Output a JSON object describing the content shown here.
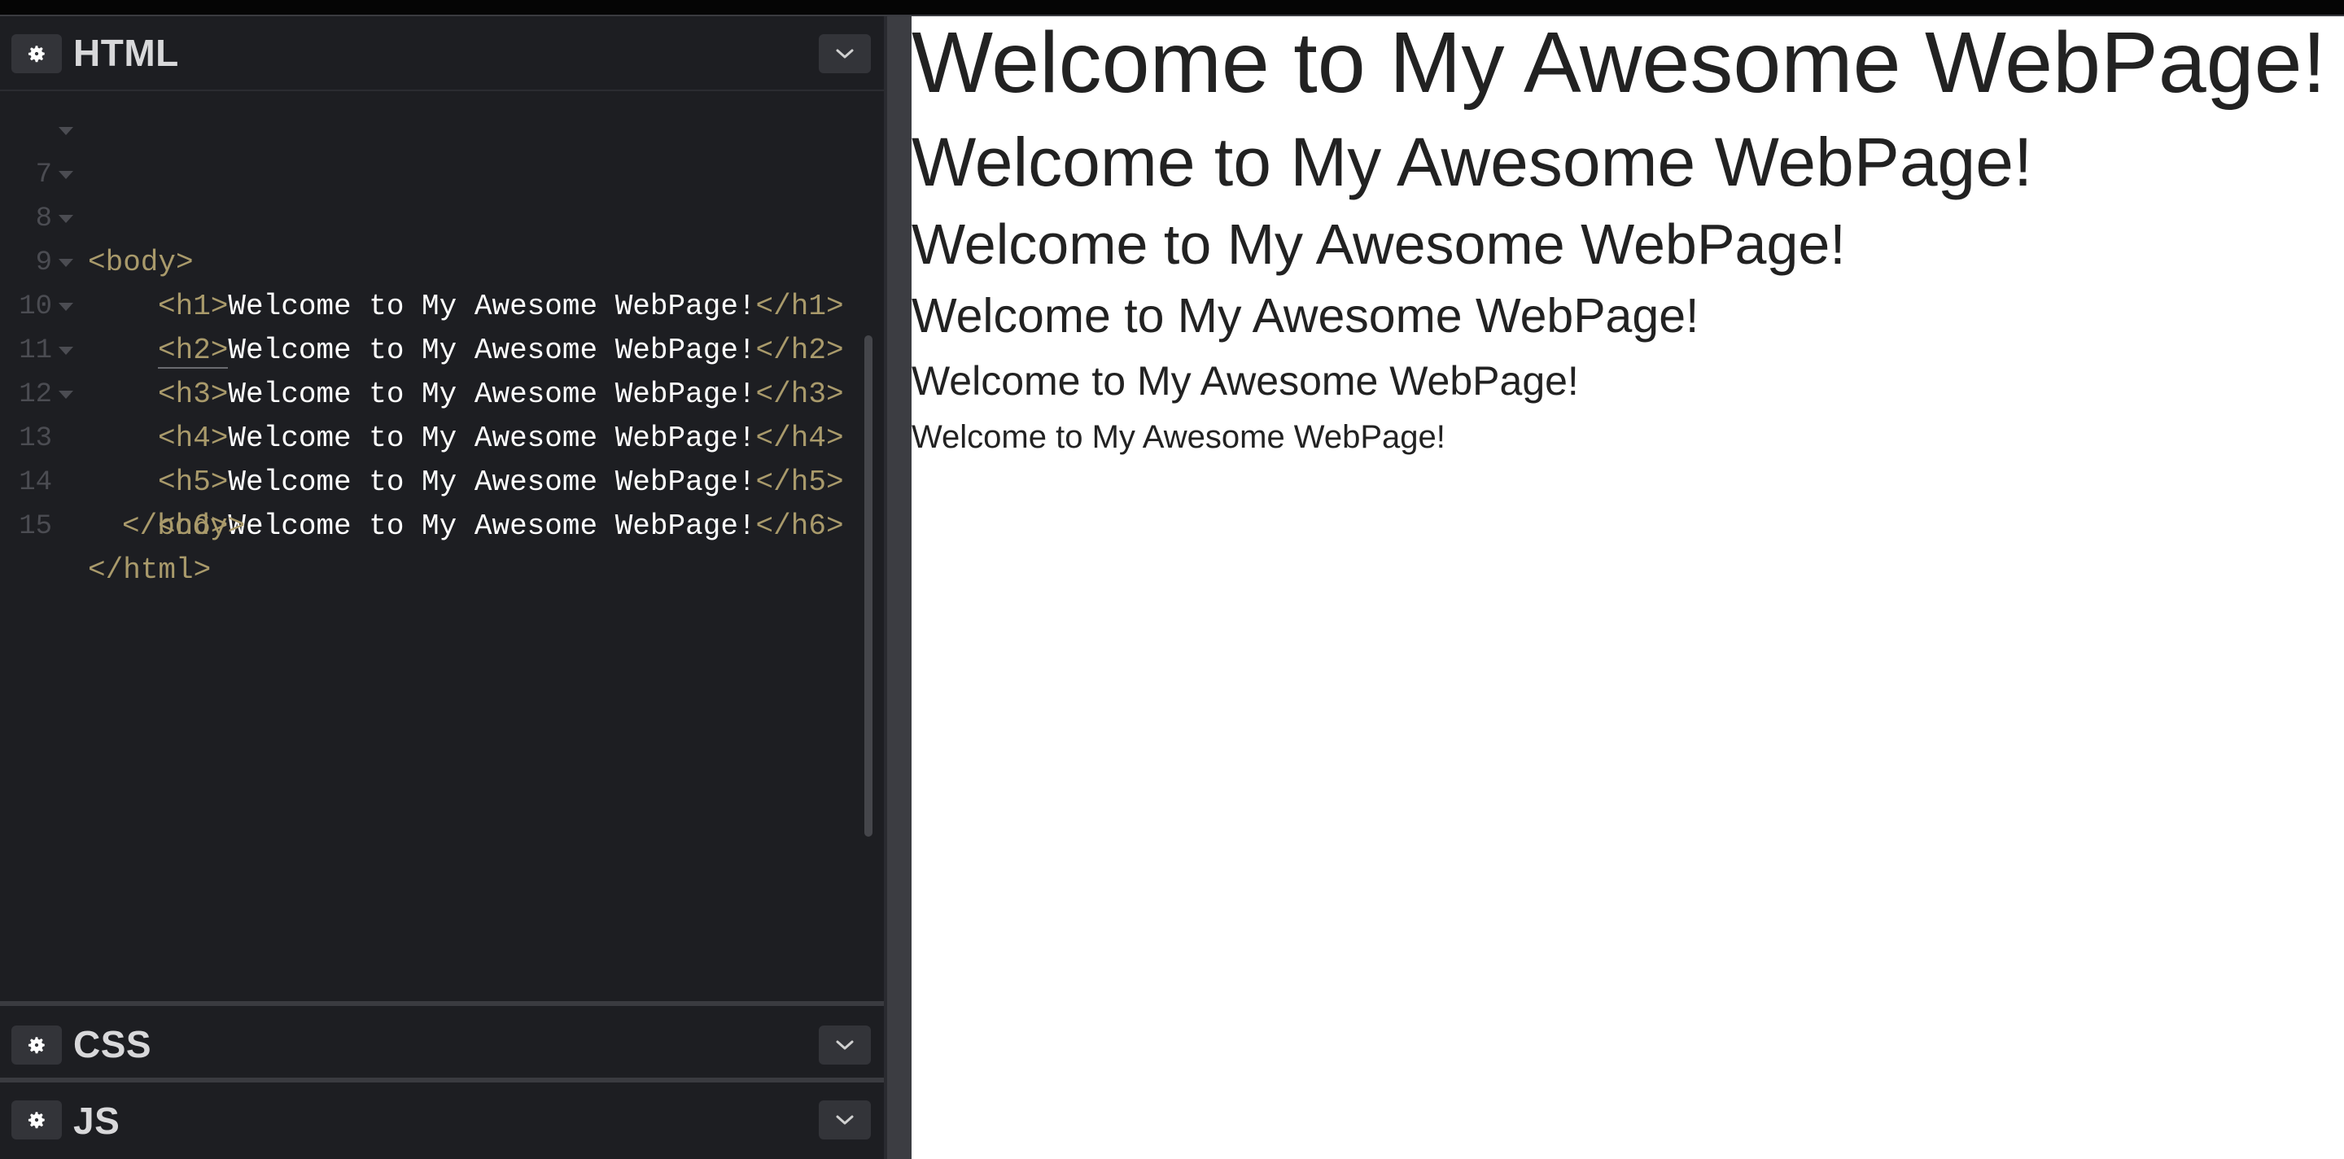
{
  "editors": {
    "html": {
      "title": "HTML"
    },
    "css": {
      "title": "CSS"
    },
    "js": {
      "title": "JS"
    }
  },
  "code_lines": [
    {
      "num": "7",
      "indent": "  ",
      "open": "<body>",
      "text": "",
      "close": ""
    },
    {
      "num": "8",
      "indent": "    ",
      "open": "<h1>",
      "text": "Welcome to My Awesome WebPage!",
      "close": "</h1>"
    },
    {
      "num": "9",
      "indent": "    ",
      "open": "<h2>",
      "text": "Welcome to My Awesome WebPage!",
      "close": "</h2>"
    },
    {
      "num": "10",
      "indent": "    ",
      "open": "<h3>",
      "text": "Welcome to My Awesome WebPage!",
      "close": "</h3>"
    },
    {
      "num": "11",
      "indent": "    ",
      "open": "<h4>",
      "text": "Welcome to My Awesome WebPage!",
      "close": "</h4>"
    },
    {
      "num": "12",
      "indent": "    ",
      "open": "<h5>",
      "text": "Welcome to My Awesome WebPage!",
      "close": "</h5>"
    },
    {
      "num": "13",
      "indent": "    ",
      "open": "<h6>",
      "text": "Welcome to My Awesome WebPage!",
      "close": "</h6>"
    },
    {
      "num": "14",
      "indent": "  ",
      "open": "</body>",
      "text": "",
      "close": ""
    },
    {
      "num": "15",
      "indent": "",
      "open": "</html>",
      "text": "",
      "close": ""
    }
  ],
  "preview": {
    "h1": "Welcome to My Awesome WebPage!",
    "h2": "Welcome to My Awesome WebPage!",
    "h3": "Welcome to My Awesome WebPage!",
    "h4": "Welcome to My Awesome WebPage!",
    "h5": "Welcome to My Awesome WebPage!",
    "h6": "Welcome to My Awesome WebPage!"
  },
  "icons": {
    "settings": "gear-icon",
    "collapse": "chevron-down-icon"
  },
  "colors": {
    "editor_bg": "#1d1e22",
    "tag": "#a99a6b",
    "text": "#ffffff",
    "line_number": "#4b4c52",
    "preview_text": "#222222"
  }
}
